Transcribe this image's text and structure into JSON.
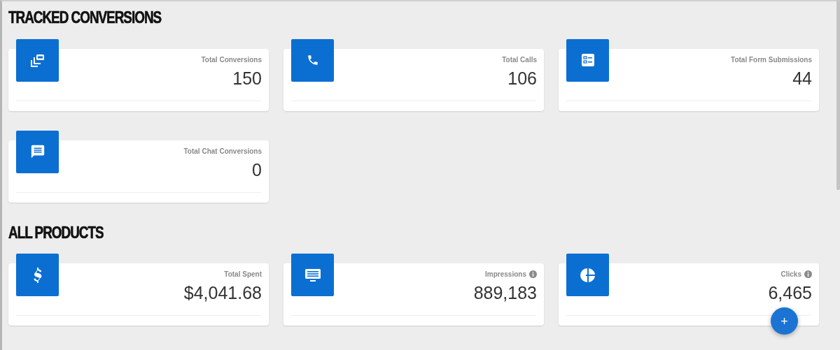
{
  "sections": [
    {
      "title": "TRACKED CONVERSIONS",
      "cards": [
        {
          "kind": "conversions",
          "label": "Total Conversions",
          "info": false,
          "value": "150"
        },
        {
          "kind": "calls",
          "label": "Total Calls",
          "info": false,
          "value": "106"
        },
        {
          "kind": "forms",
          "label": "Total Form Submissions",
          "info": false,
          "value": "44"
        },
        {
          "kind": "chat",
          "label": "Total Chat Conversions",
          "info": false,
          "value": "0"
        }
      ]
    },
    {
      "title": "ALL PRODUCTS",
      "cards": [
        {
          "kind": "spent",
          "label": "Total Spent",
          "info": false,
          "value": "$4,041.68"
        },
        {
          "kind": "impressions",
          "label": "Impressions",
          "info": true,
          "value": "889,183"
        },
        {
          "kind": "clicks",
          "label": "Clicks",
          "info": true,
          "value": "6,465"
        }
      ]
    }
  ],
  "fab": {
    "label": "+"
  }
}
